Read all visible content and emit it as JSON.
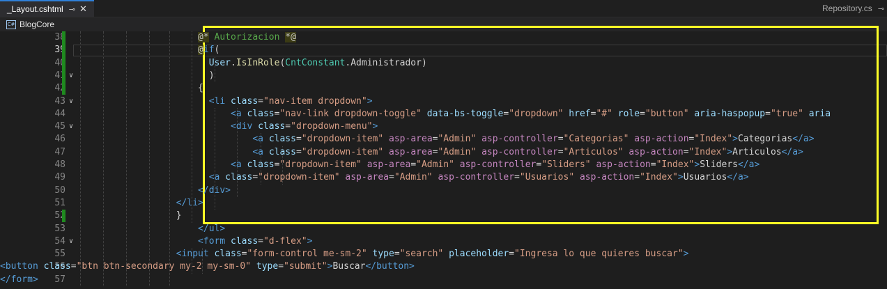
{
  "tabs": {
    "active_title": "_Layout.cshtml",
    "active_pin": "⊸",
    "active_close": "✕",
    "other_title": "Repository.cs",
    "other_pin": "⊸"
  },
  "navbar": {
    "project_icon": "C#",
    "project": "BlogCore"
  },
  "lines": [
    {
      "n": "38",
      "parts": [
        [
          "razor",
          "@*"
        ],
        [
          "comment",
          " Autorizacion "
        ],
        [
          "razor",
          "*@"
        ]
      ]
    },
    {
      "n": "39",
      "parts": [
        [
          "razor",
          "@"
        ],
        [
          "kw",
          "if"
        ],
        [
          "text",
          "("
        ]
      ]
    },
    {
      "n": "40",
      "parts": [
        [
          "prop",
          "User"
        ],
        [
          "text",
          "."
        ],
        [
          "id",
          "IsInRole"
        ],
        [
          "text",
          "("
        ],
        [
          "cls",
          "CntConstant"
        ],
        [
          "text",
          ".Administrador)"
        ]
      ]
    },
    {
      "n": "41",
      "parts": [
        [
          "text",
          ")"
        ]
      ]
    },
    {
      "n": "42",
      "parts": [
        [
          "text",
          "{"
        ]
      ]
    },
    {
      "n": "43",
      "parts": [
        [
          "tag",
          "<li"
        ],
        [
          "attr",
          " class"
        ],
        [
          "text",
          "="
        ],
        [
          "str",
          "\"nav-item dropdown\""
        ],
        [
          "tag",
          ">"
        ]
      ]
    },
    {
      "n": "44",
      "parts": [
        [
          "tag",
          "<a"
        ],
        [
          "attr",
          " class"
        ],
        [
          "text",
          "="
        ],
        [
          "str",
          "\"nav-link dropdown-toggle\""
        ],
        [
          "attr",
          " data-bs-toggle"
        ],
        [
          "text",
          "="
        ],
        [
          "str",
          "\"dropdown\""
        ],
        [
          "attr",
          " href"
        ],
        [
          "text",
          "="
        ],
        [
          "str",
          "\"#\""
        ],
        [
          "attr",
          " role"
        ],
        [
          "text",
          "="
        ],
        [
          "str",
          "\"button\""
        ],
        [
          "attr",
          " aria-haspopup"
        ],
        [
          "text",
          "="
        ],
        [
          "str",
          "\"true\""
        ],
        [
          "attr",
          " aria"
        ]
      ]
    },
    {
      "n": "45",
      "parts": [
        [
          "tag",
          "<div"
        ],
        [
          "attr",
          " class"
        ],
        [
          "text",
          "="
        ],
        [
          "str",
          "\"dropdown-menu\""
        ],
        [
          "tag",
          ">"
        ]
      ]
    },
    {
      "n": "46",
      "parts": [
        [
          "tag",
          "<a"
        ],
        [
          "attr",
          " class"
        ],
        [
          "text",
          "="
        ],
        [
          "str",
          "\"dropdown-item\""
        ],
        [
          "asp",
          " asp-area"
        ],
        [
          "text",
          "="
        ],
        [
          "str",
          "\"Admin\""
        ],
        [
          "asp",
          " asp-controller"
        ],
        [
          "text",
          "="
        ],
        [
          "str",
          "\"Categorias\""
        ],
        [
          "asp",
          " asp-action"
        ],
        [
          "text",
          "="
        ],
        [
          "str",
          "\"Index\""
        ],
        [
          "tag",
          ">"
        ],
        [
          "text",
          "Categorias"
        ],
        [
          "tag",
          "</a>"
        ]
      ]
    },
    {
      "n": "47",
      "parts": [
        [
          "tag",
          "<a"
        ],
        [
          "attr",
          " class"
        ],
        [
          "text",
          "="
        ],
        [
          "str",
          "\"dropdown-item\""
        ],
        [
          "asp",
          " asp-area"
        ],
        [
          "text",
          "="
        ],
        [
          "str",
          "\"Admin\""
        ],
        [
          "asp",
          " asp-controller"
        ],
        [
          "text",
          "="
        ],
        [
          "str",
          "\"Articulos\""
        ],
        [
          "asp",
          " asp-action"
        ],
        [
          "text",
          "="
        ],
        [
          "str",
          "\"Index\""
        ],
        [
          "tag",
          ">"
        ],
        [
          "text",
          "Articulos"
        ],
        [
          "tag",
          "</a>"
        ]
      ]
    },
    {
      "n": "48",
      "parts": [
        [
          "tag",
          "<a"
        ],
        [
          "attr",
          " class"
        ],
        [
          "text",
          "="
        ],
        [
          "str",
          "\"dropdown-item\""
        ],
        [
          "asp",
          " asp-area"
        ],
        [
          "text",
          "="
        ],
        [
          "str",
          "\"Admin\""
        ],
        [
          "asp",
          " asp-controller"
        ],
        [
          "text",
          "="
        ],
        [
          "str",
          "\"Sliders\""
        ],
        [
          "asp",
          " asp-action"
        ],
        [
          "text",
          "="
        ],
        [
          "str",
          "\"Index\""
        ],
        [
          "tag",
          ">"
        ],
        [
          "text",
          "Sliders"
        ],
        [
          "tag",
          "</a>"
        ]
      ]
    },
    {
      "n": "49",
      "parts": [
        [
          "tag",
          "<a"
        ],
        [
          "attr",
          " class"
        ],
        [
          "text",
          "="
        ],
        [
          "str",
          "\"dropdown-item\""
        ],
        [
          "asp",
          " asp-area"
        ],
        [
          "text",
          "="
        ],
        [
          "str",
          "\"Admin\""
        ],
        [
          "asp",
          " asp-controller"
        ],
        [
          "text",
          "="
        ],
        [
          "str",
          "\"Usuarios\""
        ],
        [
          "asp",
          " asp-action"
        ],
        [
          "text",
          "="
        ],
        [
          "str",
          "\"Index\""
        ],
        [
          "tag",
          ">"
        ],
        [
          "text",
          "Usuarios"
        ],
        [
          "tag",
          "</a>"
        ]
      ]
    },
    {
      "n": "50",
      "parts": [
        [
          "tag",
          "</div>"
        ]
      ]
    },
    {
      "n": "51",
      "parts": [
        [
          "tag",
          "</li>"
        ]
      ]
    },
    {
      "n": "52",
      "parts": [
        [
          "text",
          "}"
        ]
      ]
    },
    {
      "n": "53",
      "parts": [
        [
          "tag",
          "</ul>"
        ]
      ]
    },
    {
      "n": "54",
      "parts": [
        [
          "tag",
          "<form"
        ],
        [
          "attr",
          " class"
        ],
        [
          "text",
          "="
        ],
        [
          "str",
          "\"d-flex\""
        ],
        [
          "tag",
          ">"
        ]
      ]
    },
    {
      "n": "55",
      "parts": [
        [
          "tag",
          "<input"
        ],
        [
          "attr",
          " class"
        ],
        [
          "text",
          "="
        ],
        [
          "str",
          "\"form-control me-sm-2\""
        ],
        [
          "attr",
          " type"
        ],
        [
          "text",
          "="
        ],
        [
          "str",
          "\"search\""
        ],
        [
          "attr",
          " placeholder"
        ],
        [
          "text",
          "="
        ],
        [
          "str",
          "\"Ingresa lo que quieres buscar\""
        ],
        [
          "tag",
          ">"
        ]
      ]
    },
    {
      "n": "56",
      "parts": [
        [
          "tag",
          "<button"
        ],
        [
          "attr",
          " class"
        ],
        [
          "text",
          "="
        ],
        [
          "str",
          "\"btn btn-secondary my-2 my-sm-0\""
        ],
        [
          "attr",
          " type"
        ],
        [
          "text",
          "="
        ],
        [
          "str",
          "\"submit\""
        ],
        [
          "tag",
          ">"
        ],
        [
          "text",
          "Buscar"
        ],
        [
          "tag",
          "</button>"
        ]
      ]
    },
    {
      "n": "57",
      "parts": [
        [
          "tag",
          "</form>"
        ]
      ]
    }
  ],
  "colors": {
    "highlight_box": "#ffff26",
    "change_marker": "#1f8a1f",
    "tab_accent": "#2f80d8"
  }
}
